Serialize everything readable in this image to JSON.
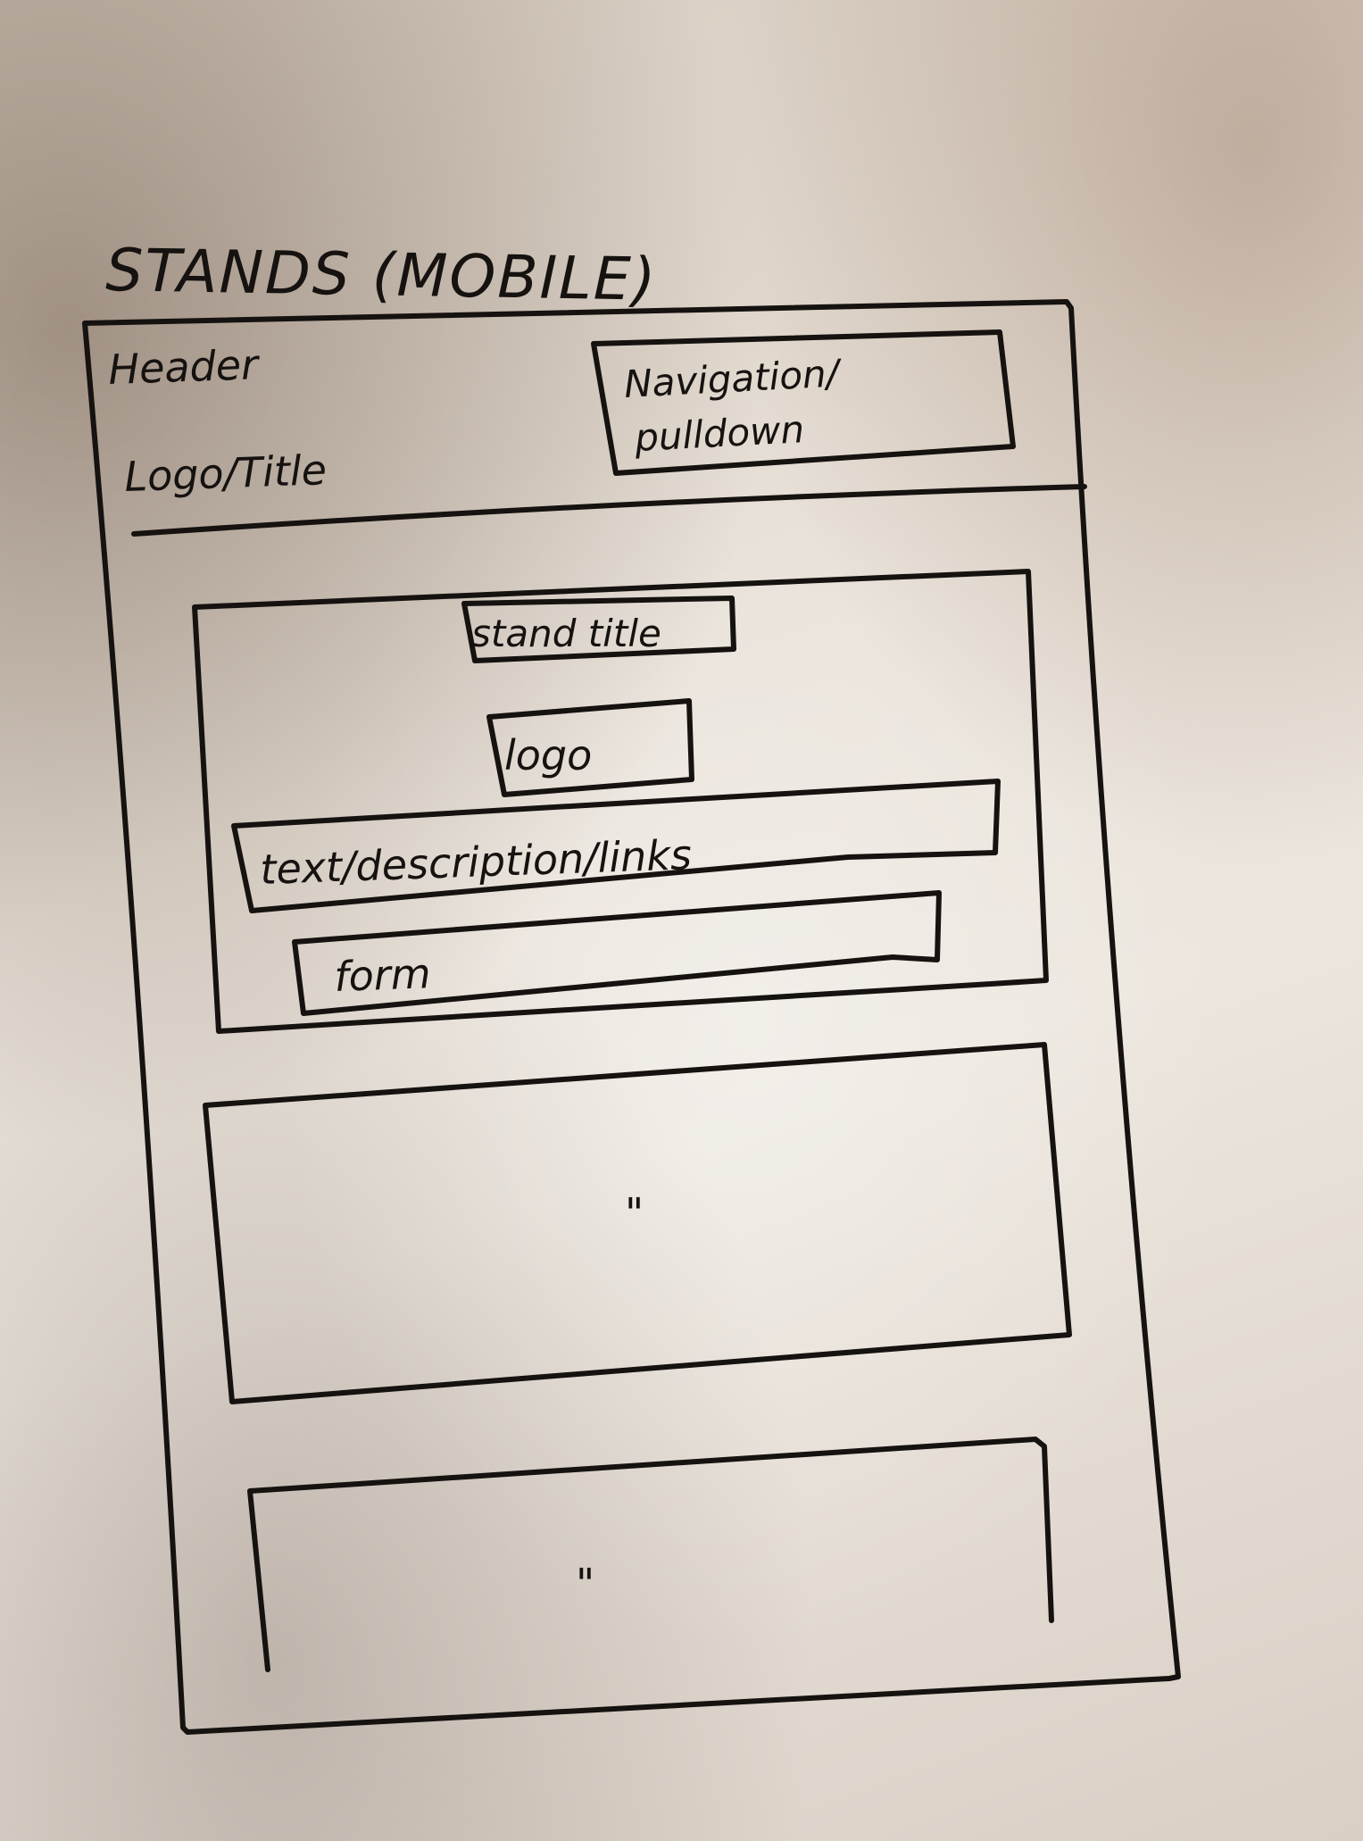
{
  "heading": "STANDS (MOBILE)",
  "header": {
    "label": "Header",
    "logo_title": "Logo/Title",
    "nav_label_line1": "Navigation/",
    "nav_label_line2": "pulldown"
  },
  "stand_card": {
    "title": "stand title",
    "logo": "logo",
    "text": "text/description/links",
    "form": "form"
  },
  "repeat_marks": [
    "\"",
    "\""
  ]
}
